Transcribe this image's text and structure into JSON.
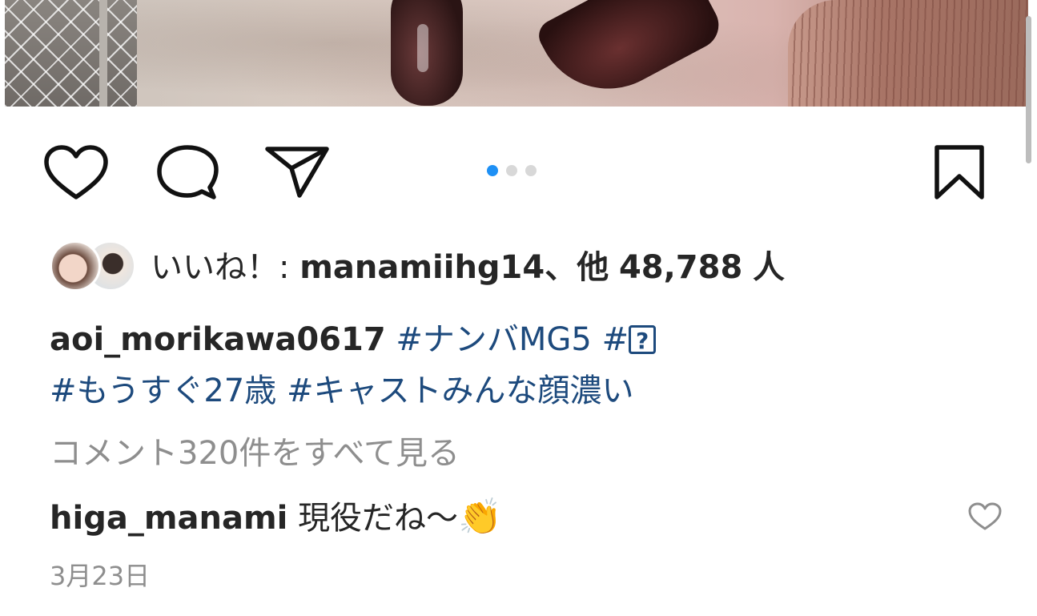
{
  "actions": {
    "like_icon": "heart-icon",
    "comment_icon": "comment-bubble-icon",
    "share_icon": "paper-plane-icon",
    "save_icon": "bookmark-icon"
  },
  "carousel": {
    "total": 3,
    "active_index": 0,
    "active_color": "#1e90f5",
    "inactive_color": "#d8d8d8"
  },
  "likes": {
    "prefix": "いいね！: ",
    "user": "manamiihg14",
    "mid": "、他",
    "count": "48,788",
    "suffix": "人"
  },
  "caption": {
    "username": "aoi_morikawa0617",
    "tag_1": "#ナンバMG5",
    "tag_2_prefix": "#",
    "tag_2_glyph": "?",
    "tag_3": "#もうすぐ27歳",
    "tag_4": "#キャストみんな顔濃い"
  },
  "view_comments": "コメント320件をすべて見る",
  "comment": {
    "username": "higa_manami",
    "text": "現役だね〜",
    "emoji": "👏",
    "like_icon": "heart-icon"
  },
  "date": "3月23日",
  "colors": {
    "hashtag": "#1d4a7d",
    "text": "#262626",
    "muted": "#8e8e8e"
  }
}
